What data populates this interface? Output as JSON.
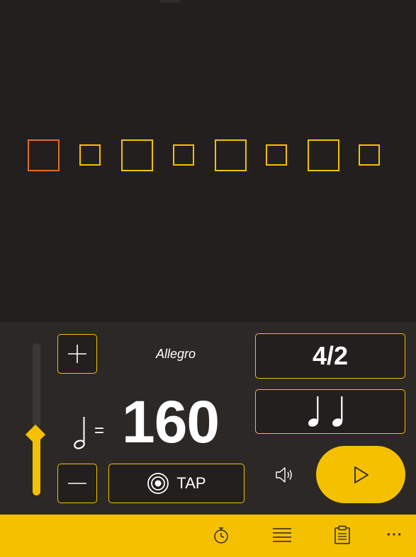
{
  "beats": [
    {
      "size": "large",
      "active": true
    },
    {
      "size": "small",
      "active": false
    },
    {
      "size": "large",
      "active": false
    },
    {
      "size": "small",
      "active": false
    },
    {
      "size": "large",
      "active": false
    },
    {
      "size": "small",
      "active": false
    },
    {
      "size": "large",
      "active": false
    },
    {
      "size": "small",
      "active": false
    }
  ],
  "colors": {
    "accent": "#f5c000",
    "active_beat": "#e46c22",
    "background": "#221f1e",
    "panel": "#2b2826"
  },
  "tempo": {
    "name": "Allegro",
    "bpm": "160",
    "equals": "=",
    "slider_level": 0.4
  },
  "tap": {
    "label": "TAP"
  },
  "time_signature": {
    "label": "4/2"
  },
  "icons": {
    "plus": "plus-icon",
    "minus": "minus-icon",
    "half_note": "half-note-icon",
    "tap": "target-icon",
    "subdivision": "quarter-notes-icon",
    "volume": "speaker-icon",
    "play": "play-icon",
    "timer": "stopwatch-icon",
    "list": "list-icon",
    "clipboard": "clipboard-icon",
    "more": "more-icon"
  },
  "appbar": {
    "more_label": "···"
  }
}
